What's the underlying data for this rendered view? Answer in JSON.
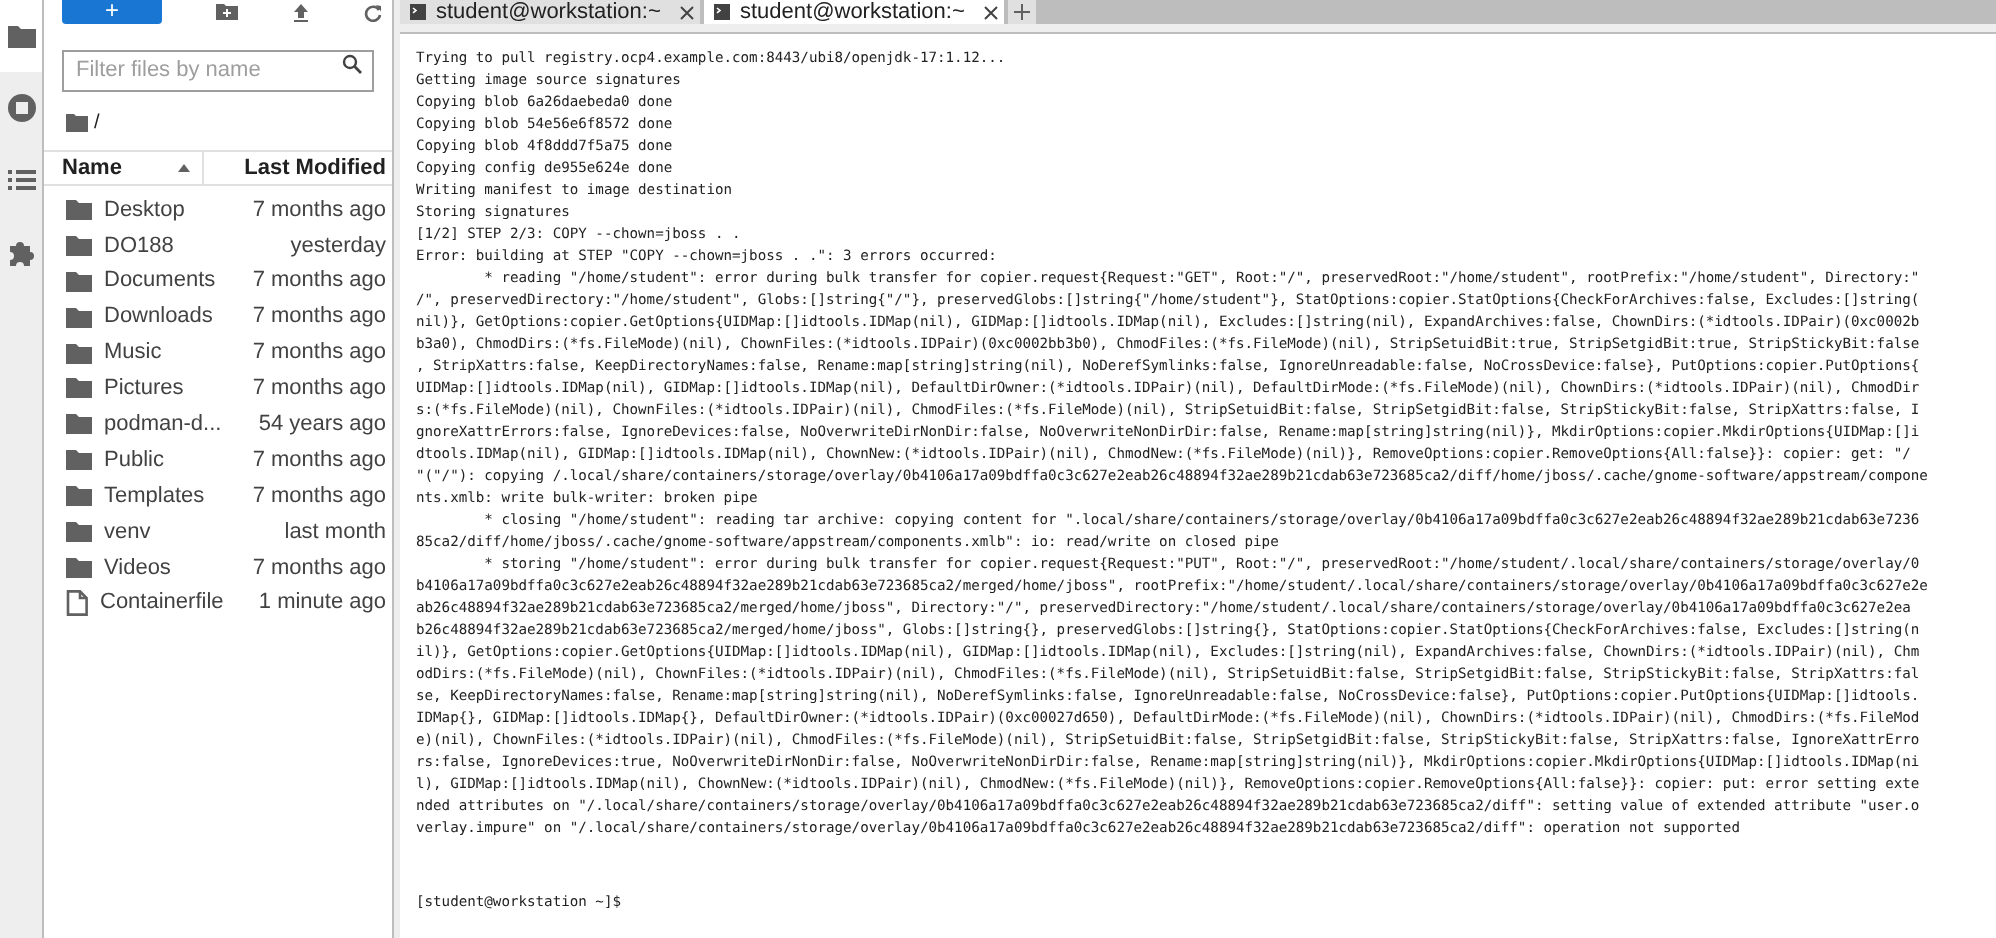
{
  "activity_bar": [
    {
      "kind": "files",
      "selected": true
    },
    {
      "kind": "running",
      "selected": false
    },
    {
      "kind": "toc",
      "selected": false
    },
    {
      "kind": "extensions",
      "selected": false
    }
  ],
  "file_browser": {
    "new_button": "+",
    "filter": {
      "placeholder": "Filter files by name"
    },
    "breadcrumb": "/",
    "columns": [
      {
        "label": "Name",
        "sorted": true
      },
      {
        "label": "Last Modified",
        "sorted": false
      }
    ],
    "rows": [
      {
        "kind": "folder",
        "name": "Desktop",
        "modified": "7 months ago"
      },
      {
        "kind": "folder",
        "name": "DO188",
        "modified": "yesterday"
      },
      {
        "kind": "folder",
        "name": "Documents",
        "modified": "7 months ago"
      },
      {
        "kind": "folder",
        "name": "Downloads",
        "modified": "7 months ago"
      },
      {
        "kind": "folder",
        "name": "Music",
        "modified": "7 months ago"
      },
      {
        "kind": "folder",
        "name": "Pictures",
        "modified": "7 months ago"
      },
      {
        "kind": "folder",
        "name": "podman-d...",
        "modified": "54 years ago"
      },
      {
        "kind": "folder",
        "name": "Public",
        "modified": "7 months ago"
      },
      {
        "kind": "folder",
        "name": "Templates",
        "modified": "7 months ago"
      },
      {
        "kind": "folder",
        "name": "venv",
        "modified": "last month"
      },
      {
        "kind": "folder",
        "name": "Videos",
        "modified": "7 months ago"
      },
      {
        "kind": "file",
        "name": "Containerfile",
        "modified": "1 minute ago"
      }
    ]
  },
  "tabs": [
    {
      "label": "student@workstation:~",
      "selected": false
    },
    {
      "label": "student@workstation:~",
      "selected": true
    }
  ],
  "terminal": {
    "lines": [
      "Trying to pull registry.ocp4.example.com:8443/ubi8/openjdk-17:1.12...",
      "Getting image source signatures",
      "Copying blob 6a26daebeda0 done",
      "Copying blob 54e56e6f8572 done",
      "Copying blob 4f8ddd7f5a75 done",
      "Copying config de955e624e done",
      "Writing manifest to image destination",
      "Storing signatures",
      "[1/2] STEP 2/3: COPY --chown=jboss . .",
      "Error: building at STEP \"COPY --chown=jboss . .\": 3 errors occurred:",
      "        * reading \"/home/student\": error during bulk transfer for copier.request{Request:\"GET\", Root:\"/\", preservedRoot:\"/home/student\", rootPrefix:\"/home/student\", Directory:\"",
      "/\", preservedDirectory:\"/home/student\", Globs:[]string{\"/\"}, preservedGlobs:[]string{\"/home/student\"}, StatOptions:copier.StatOptions{CheckForArchives:false, Excludes:[]string(",
      "nil)}, GetOptions:copier.GetOptions{UIDMap:[]idtools.IDMap(nil), GIDMap:[]idtools.IDMap(nil), Excludes:[]string(nil), ExpandArchives:false, ChownDirs:(*idtools.IDPair)(0xc0002b",
      "b3a0), ChmodDirs:(*fs.FileMode)(nil), ChownFiles:(*idtools.IDPair)(0xc0002bb3b0), ChmodFiles:(*fs.FileMode)(nil), StripSetuidBit:true, StripSetgidBit:true, StripStickyBit:false",
      ", StripXattrs:false, KeepDirectoryNames:false, Rename:map[string]string(nil), NoDerefSymlinks:false, IgnoreUnreadable:false, NoCrossDevice:false}, PutOptions:copier.PutOptions{",
      "UIDMap:[]idtools.IDMap(nil), GIDMap:[]idtools.IDMap(nil), DefaultDirOwner:(*idtools.IDPair)(nil), DefaultDirMode:(*fs.FileMode)(nil), ChownDirs:(*idtools.IDPair)(nil), ChmodDir",
      "s:(*fs.FileMode)(nil), ChownFiles:(*idtools.IDPair)(nil), ChmodFiles:(*fs.FileMode)(nil), StripSetuidBit:false, StripSetgidBit:false, StripStickyBit:false, StripXattrs:false, I",
      "gnoreXattrErrors:false, IgnoreDevices:false, NoOverwriteDirNonDir:false, NoOverwriteNonDirDir:false, Rename:map[string]string(nil)}, MkdirOptions:copier.MkdirOptions{UIDMap:[]i",
      "dtools.IDMap(nil), GIDMap:[]idtools.IDMap(nil), ChownNew:(*idtools.IDPair)(nil), ChmodNew:(*fs.FileMode)(nil)}, RemoveOptions:copier.RemoveOptions{All:false}}: copier: get: \"/",
      "\"(\"/\"): copying /.local/share/containers/storage/overlay/0b4106a17a09bdffa0c3c627e2eab26c48894f32ae289b21cdab63e723685ca2/diff/home/jboss/.cache/gnome-software/appstream/compone",
      "nts.xmlb: write bulk-writer: broken pipe",
      "        * closing \"/home/student\": reading tar archive: copying content for \".local/share/containers/storage/overlay/0b4106a17a09bdffa0c3c627e2eab26c48894f32ae289b21cdab63e7236",
      "85ca2/diff/home/jboss/.cache/gnome-software/appstream/components.xmlb\": io: read/write on closed pipe",
      "        * storing \"/home/student\": error during bulk transfer for copier.request{Request:\"PUT\", Root:\"/\", preservedRoot:\"/home/student/.local/share/containers/storage/overlay/0",
      "b4106a17a09bdffa0c3c627e2eab26c48894f32ae289b21cdab63e723685ca2/merged/home/jboss\", rootPrefix:\"/home/student/.local/share/containers/storage/overlay/0b4106a17a09bdffa0c3c627e2e",
      "ab26c48894f32ae289b21cdab63e723685ca2/merged/home/jboss\", Directory:\"/\", preservedDirectory:\"/home/student/.local/share/containers/storage/overlay/0b4106a17a09bdffa0c3c627e2ea",
      "b26c48894f32ae289b21cdab63e723685ca2/merged/home/jboss\", Globs:[]string{}, preservedGlobs:[]string{}, StatOptions:copier.StatOptions{CheckForArchives:false, Excludes:[]string(n",
      "il)}, GetOptions:copier.GetOptions{UIDMap:[]idtools.IDMap(nil), GIDMap:[]idtools.IDMap(nil), Excludes:[]string(nil), ExpandArchives:false, ChownDirs:(*idtools.IDPair)(nil), Chm",
      "odDirs:(*fs.FileMode)(nil), ChownFiles:(*idtools.IDPair)(nil), ChmodFiles:(*fs.FileMode)(nil), StripSetuidBit:false, StripSetgidBit:false, StripStickyBit:false, StripXattrs:fal",
      "se, KeepDirectoryNames:false, Rename:map[string]string(nil), NoDerefSymlinks:false, IgnoreUnreadable:false, NoCrossDevice:false}, PutOptions:copier.PutOptions{UIDMap:[]idtools.",
      "IDMap{}, GIDMap:[]idtools.IDMap{}, DefaultDirOwner:(*idtools.IDPair)(0xc00027d650), DefaultDirMode:(*fs.FileMode)(nil), ChownDirs:(*idtools.IDPair)(nil), ChmodDirs:(*fs.FileMod",
      "e)(nil), ChownFiles:(*idtools.IDPair)(nil), ChmodFiles:(*fs.FileMode)(nil), StripSetuidBit:false, StripSetgidBit:false, StripStickyBit:false, StripXattrs:false, IgnoreXattrErro",
      "rs:false, IgnoreDevices:true, NoOverwriteDirNonDir:false, NoOverwriteNonDirDir:false, Rename:map[string]string(nil)}, MkdirOptions:copier.MkdirOptions{UIDMap:[]idtools.IDMap(ni",
      "l), GIDMap:[]idtools.IDMap(nil), ChownNew:(*idtools.IDPair)(nil), ChmodNew:(*fs.FileMode)(nil)}, RemoveOptions:copier.RemoveOptions{All:false}}: copier: put: error setting exte",
      "nded attributes on \"/.local/share/containers/storage/overlay/0b4106a17a09bdffa0c3c627e2eab26c48894f32ae289b21cdab63e723685ca2/diff\": setting value of extended attribute \"user.o",
      "verlay.impure\" on \"/.local/share/containers/storage/overlay/0b4106a17a09bdffa0c3c627e2eab26c48894f32ae289b21cdab63e723685ca2/diff\": operation not supported"
    ],
    "prompt": "[student@workstation ~]$"
  }
}
